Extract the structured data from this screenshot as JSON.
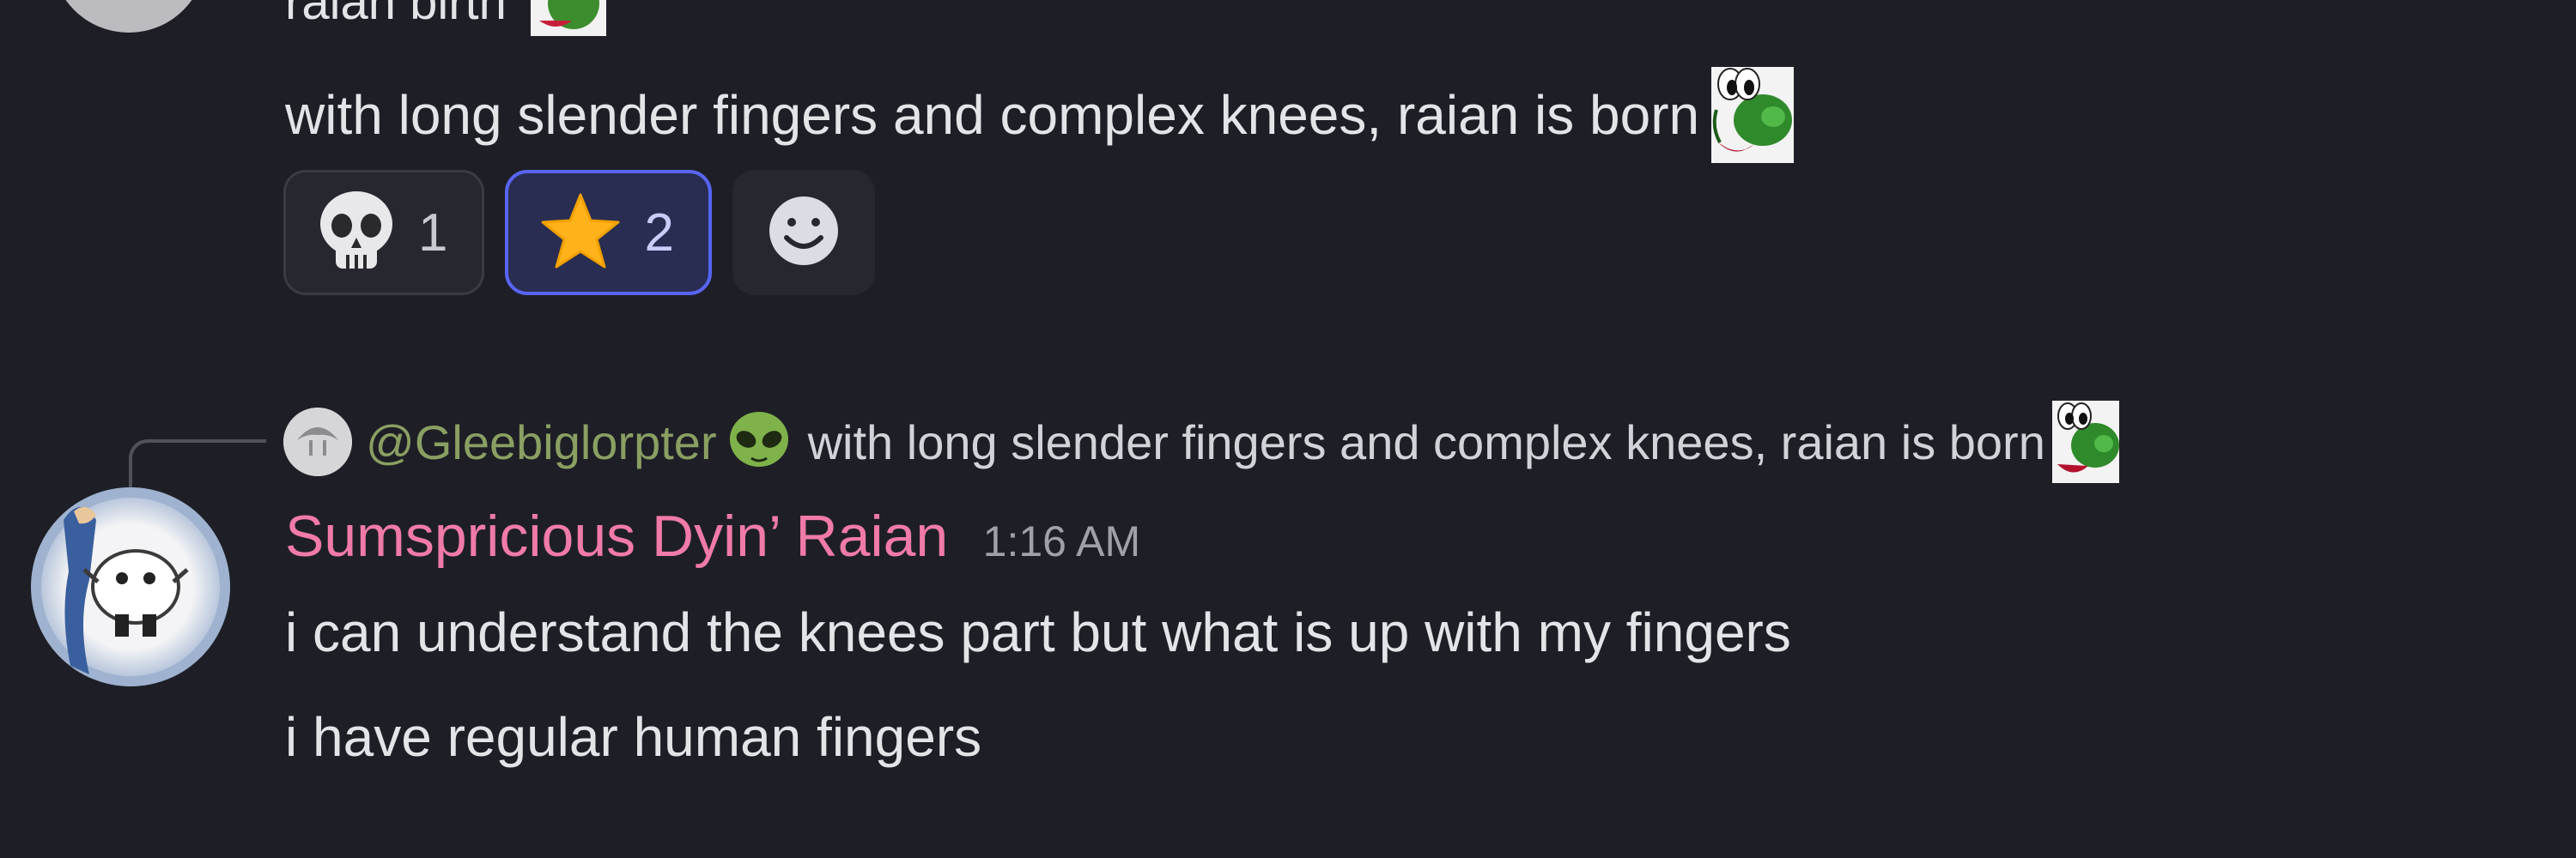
{
  "previous_message": {
    "partial_line": "raian birth",
    "text": "with long slender fingers and complex knees, raian is born",
    "emoji_name": "yoshi-icon",
    "reactions": [
      {
        "emoji": "skull-icon",
        "count": "1",
        "active": false
      },
      {
        "emoji": "star-icon",
        "count": "2",
        "active": true
      }
    ],
    "add_reaction_icon": "smiley-icon"
  },
  "reply": {
    "username": "@Gleebiglorpter",
    "user_emoji": "alien-icon",
    "text": "with long slender fingers and complex knees, raian is born",
    "emoji_name": "yoshi-icon"
  },
  "message": {
    "username": "Sumspricious Dyin’ Raian",
    "timestamp": "1:16 AM",
    "lines": [
      "i can understand the knees part but what is up with my fingers",
      "i have regular human fingers"
    ]
  },
  "colors": {
    "background": "#1e1f26",
    "username": "#f07aa8",
    "reply_username": "#8a9f62",
    "active_reaction_border": "#5865f2"
  }
}
